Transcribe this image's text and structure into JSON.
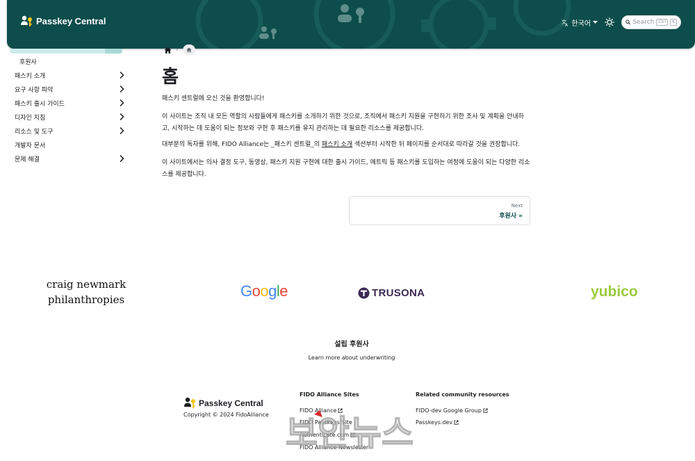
{
  "navbar": {
    "brand": "Passkey Central",
    "language": "한국어",
    "search_placeholder": "Search",
    "search_shortcut": [
      "Ctrl",
      "K"
    ],
    "background_color": "#0d4d4b",
    "icons": [
      "passkey-logo-icon",
      "translate-icon",
      "caret-down-icon",
      "sun-icon",
      "search-icon",
      "gear-icon"
    ]
  },
  "sidebar": {
    "items": [
      {
        "label": "후원사",
        "expandable": false,
        "sub": true
      },
      {
        "label": "패스키 소개",
        "expandable": true
      },
      {
        "label": "요구 사항 파악",
        "expandable": true
      },
      {
        "label": "패스키 출시 가이드",
        "expandable": true
      },
      {
        "label": "디자인 지침",
        "expandable": true
      },
      {
        "label": "리소스 및 도구",
        "expandable": true
      },
      {
        "label": "개발자 문서",
        "expandable": false
      },
      {
        "label": "문제 해결",
        "expandable": true
      }
    ],
    "active_color": "#cdebea"
  },
  "main": {
    "title": "홈",
    "p1": "패스키 센트럴에 오신 것을 환영합니다!",
    "p2": "이 사이트는 조직 내 모든 역할의 사람들에게 패스키를 소개하기 위한 것으로, 조직에서 패스키 지원을 구현하기 위한 조사 및 계획을 안내하고, 시작하는 데 도움이 되는 정보와 구현 후 패스키를 유지 관리하는 데 필요한 리소스를 제공합니다.",
    "p3_before": "대부분의 독자를 위해, FIDO Alliance는 _패스키 센트럴_의 ",
    "p3_link": "패스키 소개",
    "p3_after": " 섹션부터 시작한 뒤 페이지를 순서대로 따라갈 것을 권장합니다.",
    "p4": "이 사이트에서는 의사 결정 도구, 동영상, 패스키 지원 구현에 대한 출시 가이드, 메트릭 등 패스키를 도입하는 여정에 도움이 되는 다양한 리소스를 제공합니다.",
    "pager_sub": "Next",
    "pager_label": "후원사 »"
  },
  "sponsors": {
    "craig_line1": "craig newmark",
    "craig_line2": "philanthropies",
    "google": [
      "G",
      "o",
      "o",
      "g",
      "l",
      "e"
    ],
    "google_colors": [
      "#4285f4",
      "#ea4335",
      "#fbbc05",
      "#4285f4",
      "#34a853",
      "#ea4335"
    ],
    "trusona": "TRUSONA",
    "trusona_color": "#3e2a55",
    "yubico": "yubico",
    "yubico_color": "#9aca3c",
    "founding_title": "설립 후원사",
    "underwriting_link": "Learn more about underwriting"
  },
  "footer": {
    "brand": "Passkey Central",
    "copyright": "Copyright © 2024 FidoAlliance",
    "col1_title": "FIDO Alliance Sites",
    "col1_links": [
      "FIDO Alliance",
      "FIDO Passkeys Site",
      "Authenticate.com",
      "FIDO Alliance Newsletter"
    ],
    "col2_title": "Related community resources",
    "col2_links": [
      "FIDO-dev Google Group",
      "Passkeys.dev"
    ]
  },
  "watermark": {
    "text": "보안뉴스"
  }
}
